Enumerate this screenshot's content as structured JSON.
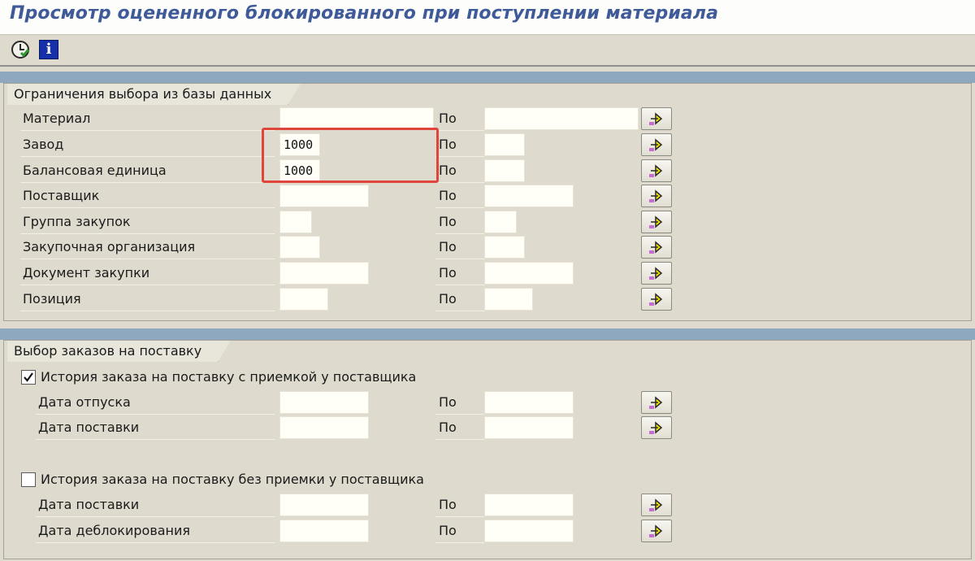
{
  "window": {
    "title": "Просмотр оцененного блокированного при поступлении материала"
  },
  "toolbar": {
    "execute_icon": "clock-execute-icon",
    "info_icon": "info-icon",
    "info_glyph": "i"
  },
  "section1": {
    "title": "Ограничения выбора из базы данных",
    "to_label": "По",
    "rows": [
      {
        "label": "Материал",
        "from": "",
        "to": ""
      },
      {
        "label": "Завод",
        "from": "1000",
        "to": ""
      },
      {
        "label": "Балансовая единица",
        "from": "1000",
        "to": ""
      },
      {
        "label": "Поставщик",
        "from": "",
        "to": ""
      },
      {
        "label": "Группа закупок",
        "from": "",
        "to": ""
      },
      {
        "label": "Закупочная организация",
        "from": "",
        "to": ""
      },
      {
        "label": "Документ закупки",
        "from": "",
        "to": ""
      },
      {
        "label": "Позиция",
        "from": "",
        "to": ""
      }
    ]
  },
  "section2": {
    "title": "Выбор заказов на поставку",
    "to_label": "По",
    "options": [
      {
        "label": "История заказа на поставку с приемкой у поставщика",
        "checked": true,
        "rows": [
          {
            "label": "Дата отпуска",
            "from": "",
            "to": ""
          },
          {
            "label": "Дата поставки",
            "from": "",
            "to": ""
          }
        ]
      },
      {
        "label": "История заказа на поставку без приемки у поставщика",
        "checked": false,
        "rows": [
          {
            "label": "Дата поставки",
            "from": "",
            "to": ""
          },
          {
            "label": "Дата деблокирования",
            "from": "",
            "to": ""
          }
        ]
      }
    ]
  },
  "colors": {
    "title": "#3f5a98",
    "highlight": "#e0453b",
    "band": "#8ea8bf",
    "arrow": "#f5e600"
  }
}
